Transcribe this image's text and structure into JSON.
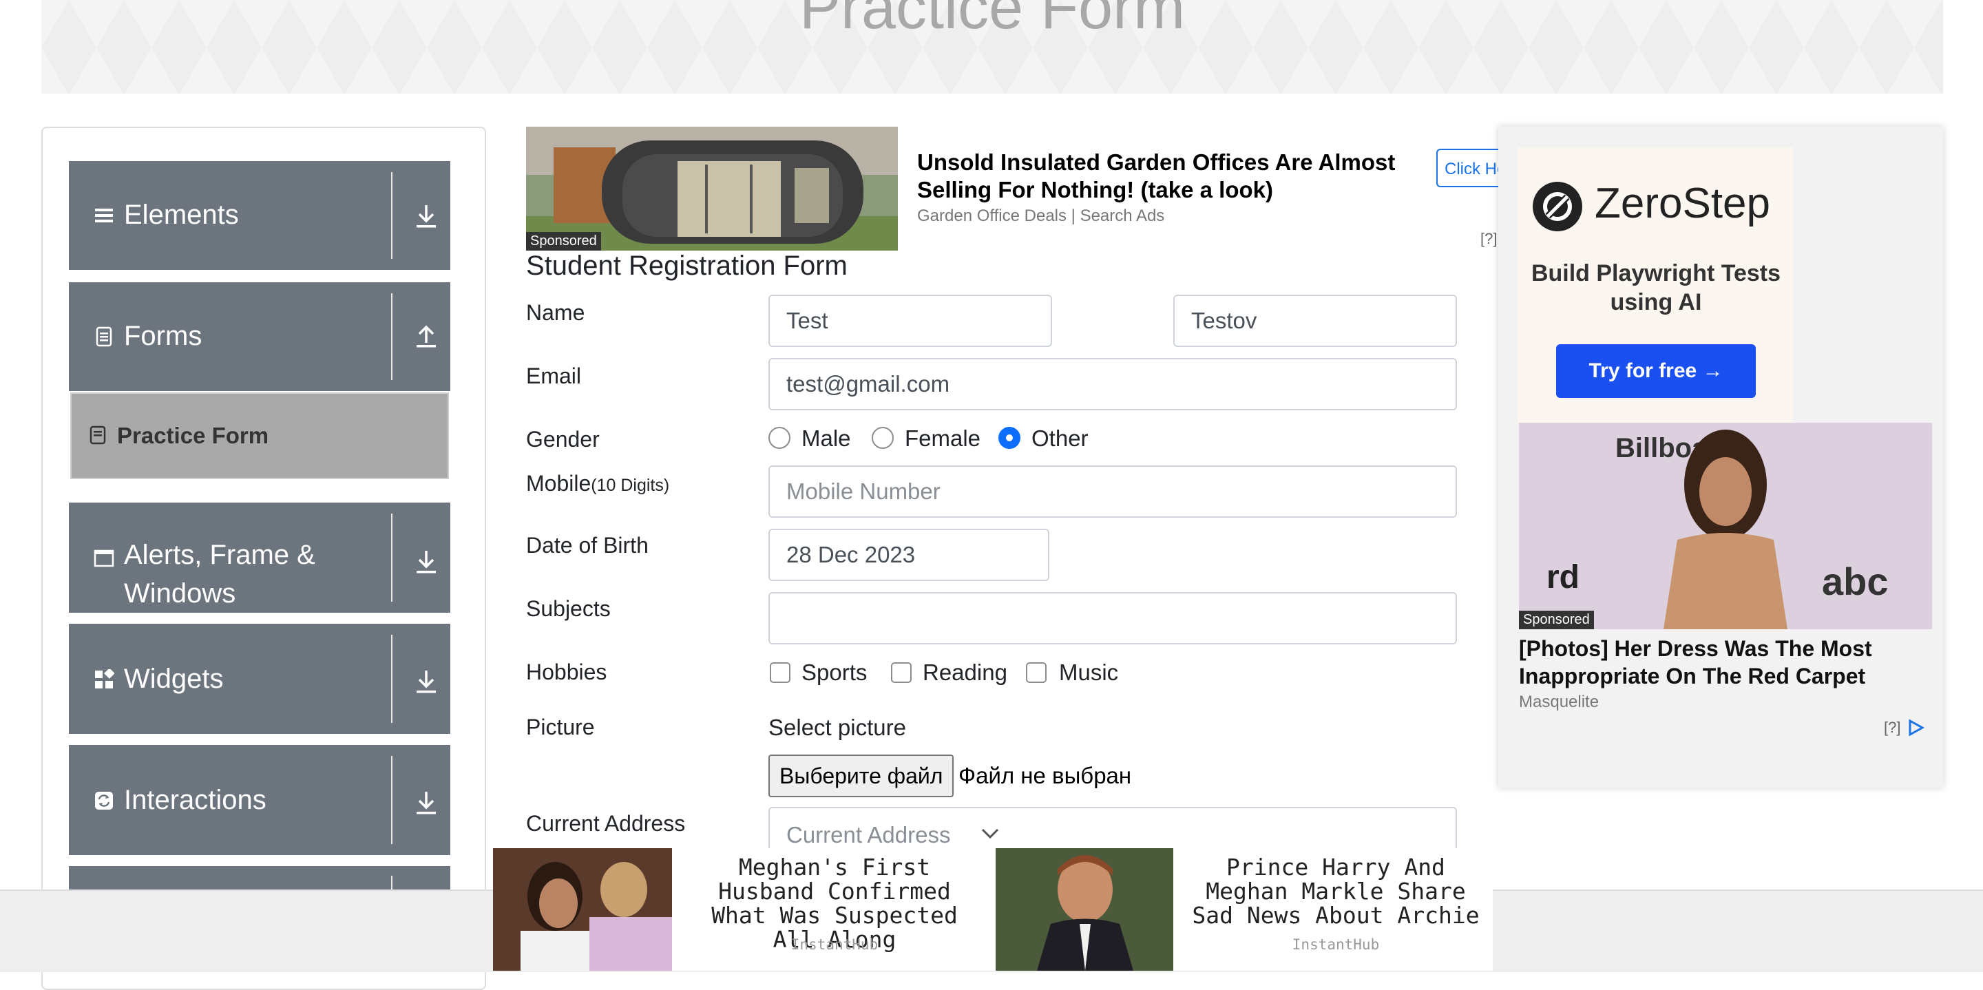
{
  "banner": {
    "title": "Practice Form"
  },
  "sidebar": {
    "groups": [
      {
        "label": "Elements",
        "icon": "list-icon",
        "arrow": "download"
      },
      {
        "label": "Forms",
        "icon": "document-icon",
        "arrow": "upload"
      },
      {
        "label_line1": "Alerts, Frame &",
        "label_line2": "Windows",
        "icon": "window-icon",
        "arrow": "download"
      },
      {
        "label": "Widgets",
        "icon": "widgets-icon",
        "arrow": "download"
      },
      {
        "label": "Interactions",
        "icon": "interactions-icon",
        "arrow": "download"
      }
    ],
    "active_item": {
      "label": "Practice Form"
    }
  },
  "ad_top": {
    "sponsored": "Sponsored",
    "headline": "Unsold Insulated Garden Offices Are Almost Selling For Nothing! (take a look)",
    "source": "Garden Office Deals | Search Ads",
    "click": "Click Here",
    "q": "[?]"
  },
  "form": {
    "title": "Student Registration Form",
    "name_label": "Name",
    "first_name": "Test",
    "last_name": "Testov",
    "email_label": "Email",
    "email": "test@gmail.com",
    "gender_label": "Gender",
    "gender_options": [
      "Male",
      "Female",
      "Other"
    ],
    "gender_selected": "Other",
    "mobile_label": "Mobile",
    "mobile_hint": "(10 Digits)",
    "mobile_placeholder": "Mobile Number",
    "dob_label": "Date of Birth",
    "dob": "28 Dec 2023",
    "subjects_label": "Subjects",
    "hobbies_label": "Hobbies",
    "hobbies": [
      "Sports",
      "Reading",
      "Music"
    ],
    "picture_label": "Picture",
    "select_picture": "Select picture",
    "file_button": "Выберите файл",
    "file_status": "Файл не выбран",
    "address_label": "Current Address",
    "address_placeholder": "Current Address"
  },
  "right_ad": {
    "brand": "ZeroStep",
    "tagline": "Build Playwright Tests using AI",
    "cta": "Try for free →",
    "sponsored": "Sponsored",
    "headline": "[Photos] Her Dress Was The Most Inappropriate On The Red Carpet",
    "source": "Masquelite",
    "q": "[?]"
  },
  "bottom_ads": [
    {
      "headline": "Meghan's First Husband Confirmed What Was Suspected All Along",
      "source": "InstantHub"
    },
    {
      "headline": "Prince Harry And Meghan Markle Share Sad News About Archie",
      "source": "InstantHub"
    }
  ],
  "colors": {
    "sidebar_header": "#6c757d",
    "active_item": "#a9a9a9",
    "radio_selected": "#0d6efd",
    "cta": "#1a4ff0"
  }
}
